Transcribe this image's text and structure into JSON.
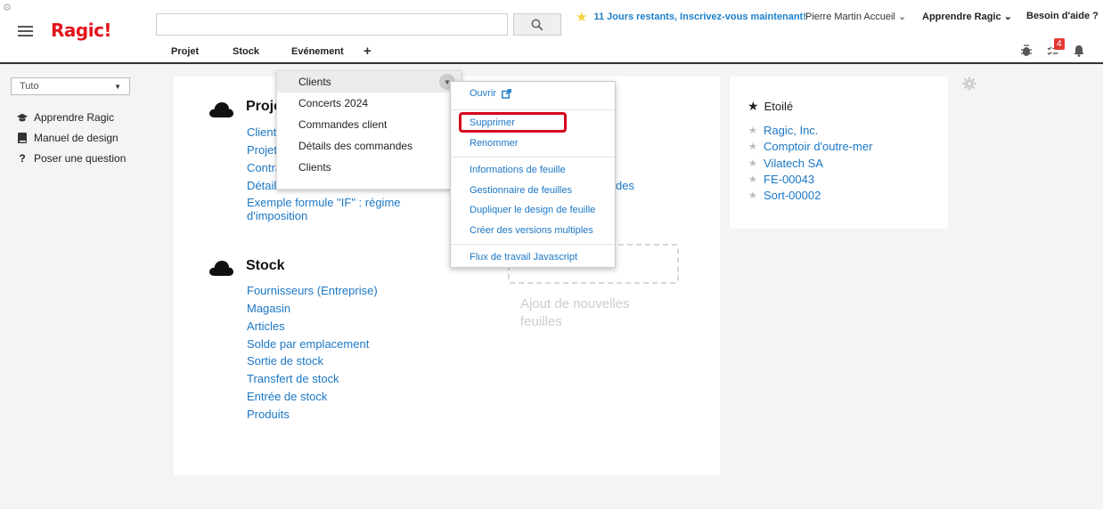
{
  "header": {
    "logo": "Ragic!",
    "search": {
      "value": "",
      "placeholder": ""
    },
    "trial_text": "11 Jours restants, Inscrivez-vous maintenant!",
    "user_menu": "Pierre Martin Accueil",
    "learn_menu": "Apprendre Ragic",
    "help_menu": "Besoin d'aide ?",
    "nav_tabs": [
      {
        "label": "Projet"
      },
      {
        "label": "Stock"
      },
      {
        "label": "Evénement"
      }
    ],
    "nav_add": "+",
    "notification_count": "4"
  },
  "sidebar": {
    "account_select": "Tuto",
    "links": [
      {
        "label": "Apprendre Ragic",
        "icon": "graduation-cap-icon"
      },
      {
        "label": "Manuel de design",
        "icon": "book-icon"
      },
      {
        "label": "Poser une question",
        "icon": "question-icon"
      }
    ]
  },
  "main": {
    "sections": [
      {
        "title": "Projet",
        "links": [
          "Clients",
          "Projet",
          "Contrat",
          "Détails",
          "Exemple formule \"IF\" : régime d'imposition"
        ]
      },
      {
        "title": "Stock",
        "links": [
          "Fournisseurs (Entreprise)",
          "Magasin",
          "Articles",
          "Solde par emplacement",
          "Sortie de stock",
          "Transfert de stock",
          "Entrée de stock",
          "Produits"
        ]
      }
    ],
    "partial_link": "des",
    "add_sheets_text": "Ajout de nouvelles feuilles"
  },
  "starred": {
    "title": "Etoilé",
    "items": [
      "Ragic, Inc.",
      "Comptoir d'outre-mer",
      "Vilatech SA",
      "FE-00043",
      "Sort-00002"
    ]
  },
  "tab_dropdown": {
    "items": [
      "Clients",
      "Concerts 2024",
      "Commandes client",
      "Détails des commandes",
      "Clients"
    ]
  },
  "context_menu": {
    "open": "Ouvrir",
    "delete": "Supprimer",
    "rename": "Renommer",
    "sheet_info": "Informations de feuille",
    "sheet_manager": "Gestionnaire de feuilles",
    "duplicate_design": "Dupliquer le design de feuille",
    "multiple_versions": "Créer des versions multiples",
    "js_workflow": "Flux de travail Javascript"
  },
  "colors": {
    "brand_red": "#e3141b",
    "link_blue": "#1b77c5",
    "highlight_red": "#d6001c",
    "trial_star": "#f5d23b"
  }
}
